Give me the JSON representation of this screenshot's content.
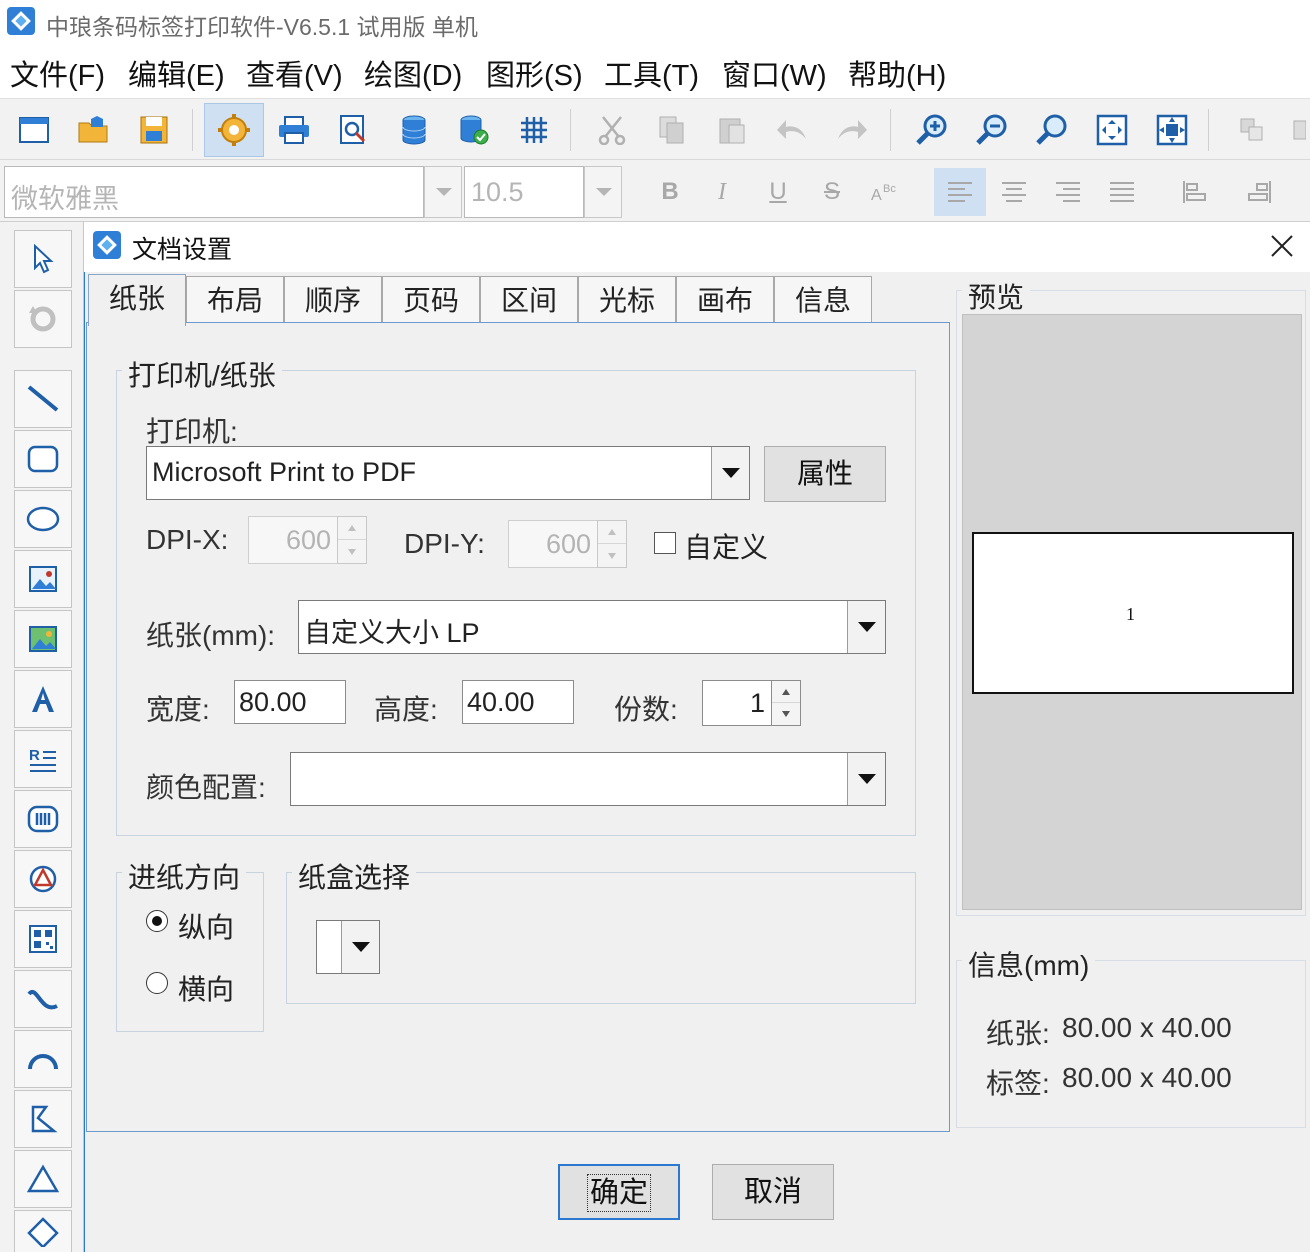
{
  "titlebar": {
    "title": "中琅条码标签打印软件-V6.5.1 试用版 单机"
  },
  "menu": {
    "items": [
      {
        "label": "文件(F)"
      },
      {
        "label": "编辑(E)"
      },
      {
        "label": "查看(V)"
      },
      {
        "label": "绘图(D)"
      },
      {
        "label": "图形(S)"
      },
      {
        "label": "工具(T)"
      },
      {
        "label": "窗口(W)"
      },
      {
        "label": "帮助(H)"
      }
    ]
  },
  "toolbar": {
    "icons": [
      "new-icon",
      "open-icon",
      "save-icon",
      "document-settings-icon",
      "print-icon",
      "print-preview-icon",
      "database-icon",
      "database-settings-icon",
      "grid-icon",
      "cut-icon",
      "copy-icon",
      "paste-icon",
      "undo-icon",
      "redo-icon",
      "zoom-in-icon",
      "zoom-out-icon",
      "zoom-icon",
      "fit-window-icon",
      "actual-size-icon",
      "layer-icon"
    ]
  },
  "formatbar": {
    "font_family": "微软雅黑",
    "font_size": "10.5",
    "bold": "B",
    "italic": "I",
    "underline": "U",
    "strike": "S"
  },
  "dialog": {
    "title": "文档设置",
    "tabs": [
      {
        "label": "纸张"
      },
      {
        "label": "布局"
      },
      {
        "label": "顺序"
      },
      {
        "label": "页码"
      },
      {
        "label": "区间"
      },
      {
        "label": "光标"
      },
      {
        "label": "画布"
      },
      {
        "label": "信息"
      }
    ],
    "printer_group": {
      "title": "打印机/纸张",
      "printer_label": "打印机:",
      "printer_value": "Microsoft Print to PDF",
      "properties_button": "属性",
      "dpi_x_label": "DPI-X:",
      "dpi_x_value": "600",
      "dpi_y_label": "DPI-Y:",
      "dpi_y_value": "600",
      "custom_label": "自定义",
      "paper_label": "纸张(mm):",
      "paper_value": "自定义大小 LP",
      "width_label": "宽度:",
      "width_value": "80.00",
      "height_label": "高度:",
      "height_value": "40.00",
      "copies_label": "份数:",
      "copies_value": "1",
      "color_label": "颜色配置:",
      "color_value": ""
    },
    "feed_group": {
      "title": "进纸方向",
      "portrait": "纵向",
      "landscape": "横向",
      "selected": "纵向"
    },
    "tray_group": {
      "title": "纸盒选择",
      "value": ""
    },
    "preview": {
      "title": "预览",
      "page_number": "1"
    },
    "info": {
      "title": "信息(mm)",
      "paper_label": "纸张:",
      "paper_value": "80.00 x 40.00",
      "label_label": "标签:",
      "label_value": "80.00 x 40.00"
    },
    "ok_button": "确定",
    "cancel_button": "取消"
  },
  "colors": {
    "accent": "#2b78d0",
    "dialog_bg": "#f0f0f0",
    "preview_bg": "#d4d4d4",
    "toolbar_active": "#cfe0f2"
  }
}
